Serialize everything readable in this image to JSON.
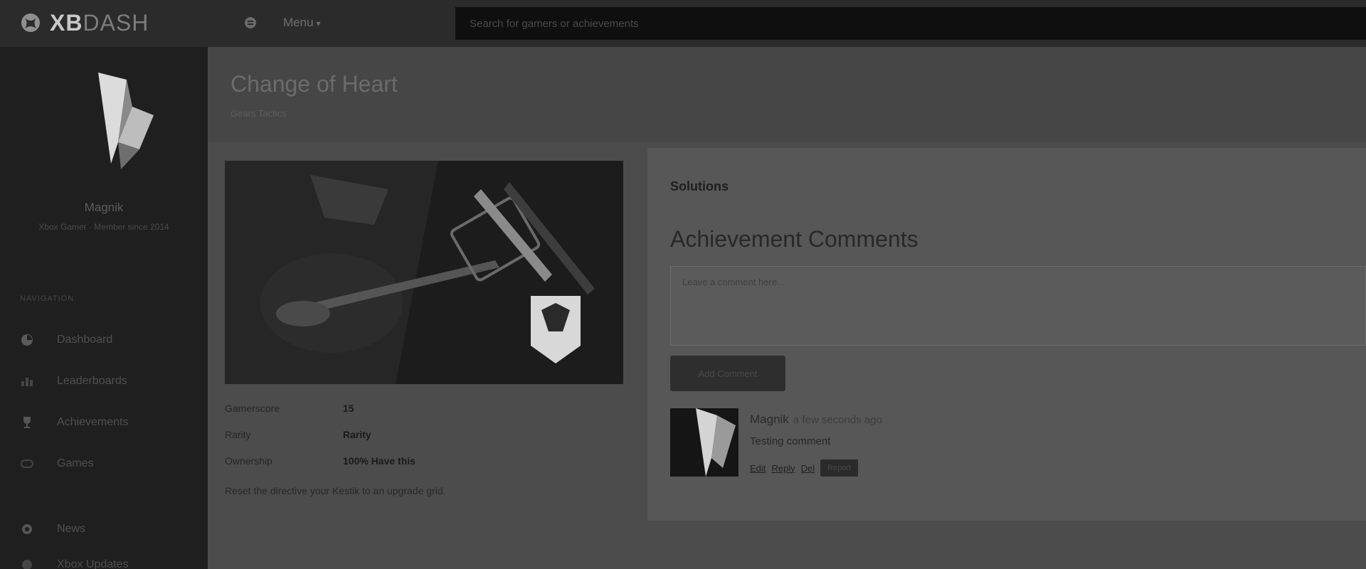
{
  "topbar": {
    "brand_bold": "XB",
    "brand_light": "DASH",
    "menu_link": "Menu",
    "search_placeholder": "Search for gamers or achievements"
  },
  "sidebar": {
    "user_name": "Magnik",
    "user_sub": "Xbox Gamer · Member since 2014",
    "nav_header": "NAVIGATION",
    "items": [
      {
        "label": "Dashboard",
        "icon": "dashboard-icon"
      },
      {
        "label": "Leaderboards",
        "icon": "leaderboard-icon"
      },
      {
        "label": "Achievements",
        "icon": "trophy-icon"
      },
      {
        "label": "Games",
        "icon": "gamepad-icon"
      },
      {
        "label": "News",
        "icon": "news-icon"
      },
      {
        "label": "Xbox Updates",
        "icon": "xbox-icon"
      }
    ]
  },
  "page": {
    "title": "Change of Heart",
    "subtitle": "Gears Tactics"
  },
  "achievement": {
    "image_label": "achievement artwork",
    "stats": [
      {
        "label": "Gamerscore",
        "value": "15"
      },
      {
        "label": "Rarity",
        "value": "Rarity"
      },
      {
        "label": "Ownership",
        "value": "100% Have this"
      }
    ],
    "description": "Reset the directive your Kestik to an upgrade grid."
  },
  "comments": {
    "solutions_title": "Solutions",
    "title": "Achievement Comments",
    "input_placeholder": "Leave a comment here...",
    "add_button": "Add Comment",
    "list": [
      {
        "author": "Magnik",
        "time": "a few seconds ago",
        "text": "Testing comment",
        "links": [
          "Edit",
          "Reply",
          "Del"
        ],
        "badge": "Report"
      }
    ]
  },
  "colors": {
    "topbar": "#2b2b2b",
    "sidebar": "#1f1f1f",
    "main_bg": "#4c4c4c",
    "panel_bg": "#575757",
    "search_bg": "#0f0f0f"
  }
}
